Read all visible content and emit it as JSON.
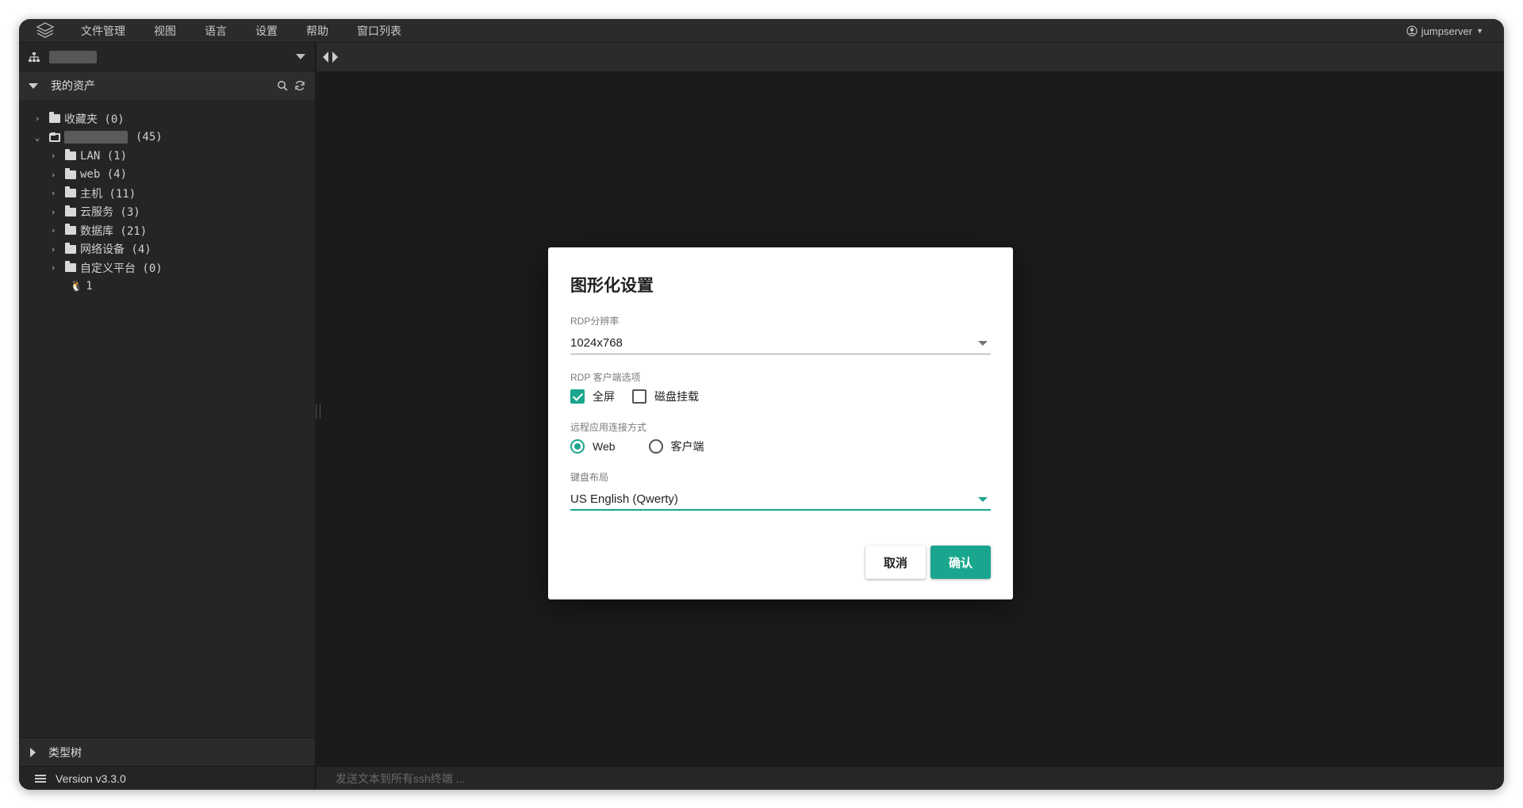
{
  "menubar": {
    "items": [
      "文件管理",
      "视图",
      "语言",
      "设置",
      "帮助",
      "窗口列表"
    ],
    "user": "jumpserver"
  },
  "sidebar": {
    "header": "我的资产",
    "tree": [
      {
        "label": "收藏夹 (0)",
        "expanded": false,
        "level": 0
      },
      {
        "label": "(45)",
        "expanded": true,
        "level": 0,
        "masked": true
      },
      {
        "label": "LAN (1)",
        "expanded": false,
        "level": 1
      },
      {
        "label": "web (4)",
        "expanded": false,
        "level": 1
      },
      {
        "label": "主机 (11)",
        "expanded": false,
        "level": 1
      },
      {
        "label": "云服务 (3)",
        "expanded": false,
        "level": 1
      },
      {
        "label": "数据库 (21)",
        "expanded": false,
        "level": 1
      },
      {
        "label": "网络设备 (4)",
        "expanded": false,
        "level": 1
      },
      {
        "label": "自定义平台 (0)",
        "expanded": false,
        "level": 1
      },
      {
        "label": "1",
        "level": 1,
        "leaf": true
      }
    ],
    "bottom_tree": "类型树",
    "version": "Version v3.3.0"
  },
  "sendbar": {
    "placeholder": "发送文本到所有ssh终端 ..."
  },
  "dialog": {
    "title": "图形化设置",
    "resolution_label": "RDP分辨率",
    "resolution_value": "1024x768",
    "client_options_label": "RDP 客户端选项",
    "fullscreen_label": "全屏",
    "fullscreen_checked": true,
    "disk_label": "磁盘挂载",
    "disk_checked": false,
    "remote_app_label": "远程应用连接方式",
    "web_label": "Web",
    "client_label": "客户端",
    "selected_mode": "Web",
    "keyboard_label": "键盘布局",
    "keyboard_value": "US English (Qwerty)",
    "cancel_label": "取消",
    "ok_label": "确认"
  },
  "colors": {
    "accent": "#1aa68e",
    "background": "#1f1f1f"
  }
}
